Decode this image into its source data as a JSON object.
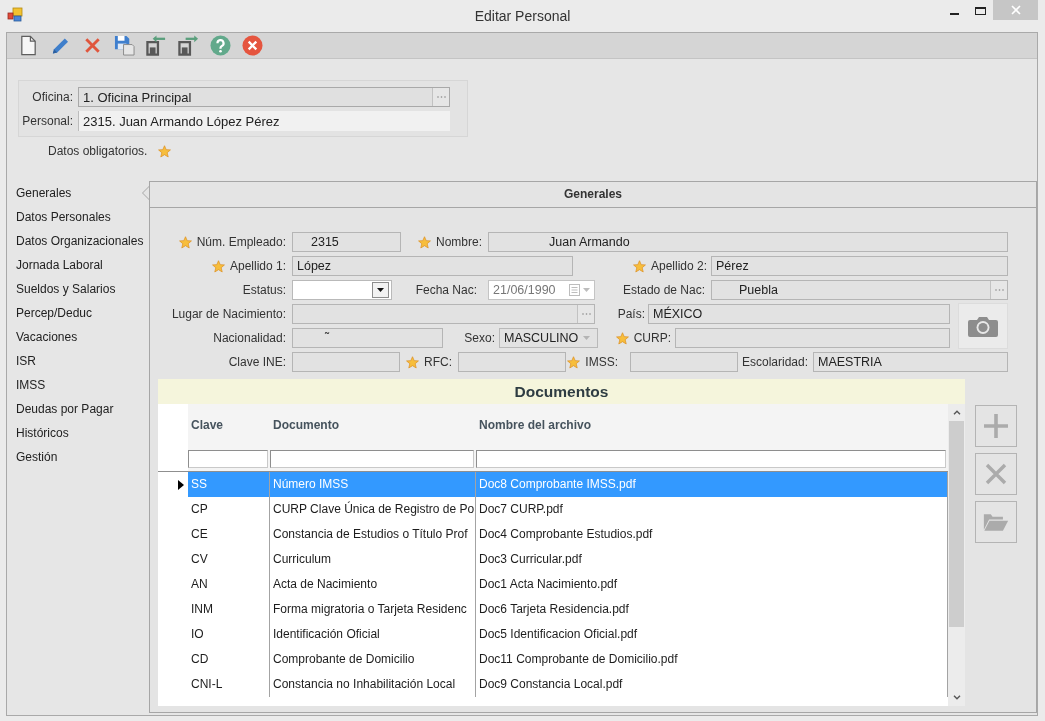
{
  "window": {
    "title": "Editar Personal"
  },
  "header": {
    "fields": [
      {
        "label": "Oficina:",
        "value": "1. Oficina Principal",
        "kind": "lookup"
      },
      {
        "label": "Personal:",
        "value": "2315. Juan Armando López Pérez",
        "kind": "text"
      }
    ],
    "required_note": "Datos obligatorios."
  },
  "sidebar": {
    "items": [
      {
        "label": "Generales",
        "selected": true
      },
      {
        "label": "Datos Personales",
        "selected": false
      },
      {
        "label": "Datos Organizacionales",
        "selected": false
      },
      {
        "label": "Jornada Laboral",
        "selected": false
      },
      {
        "label": "Sueldos y Salarios",
        "selected": false
      },
      {
        "label": "Percep/Deduc",
        "selected": false
      },
      {
        "label": "Vacaciones",
        "selected": false
      },
      {
        "label": "ISR",
        "selected": false
      },
      {
        "label": "IMSS",
        "selected": false
      },
      {
        "label": "Deudas por Pagar",
        "selected": false
      },
      {
        "label": "Históricos",
        "selected": false
      },
      {
        "label": "Gestión",
        "selected": false
      }
    ]
  },
  "panel": {
    "title": "Generales",
    "form": {
      "rows": [
        {
          "fields": [
            {
              "label": "Núm. Empleado:",
              "value": "2315",
              "required": true,
              "kind": "text",
              "disabled": false
            },
            {
              "label": "Nombre:",
              "value": "Juan Armando",
              "required": true,
              "kind": "text",
              "disabled": false
            }
          ]
        },
        {
          "fields": [
            {
              "label": "Apellido 1:",
              "value": "López",
              "required": true,
              "kind": "text",
              "disabled": false
            },
            {
              "label": "Apellido 2:",
              "value": "Pérez",
              "required": true,
              "kind": "text",
              "disabled": false
            }
          ]
        },
        {
          "fields": [
            {
              "label": "Estatus:",
              "required": false,
              "kind": "combo",
              "disabled": false
            },
            {
              "label": "Fecha Nac:",
              "value": "21/06/1990",
              "required": false,
              "kind": "date",
              "disabled": true
            },
            {
              "label": "Estado de Nac:",
              "value": "Puebla",
              "required": false,
              "kind": "lookup",
              "disabled": false
            }
          ]
        },
        {
          "fields": [
            {
              "label": "Lugar de Nacimiento:",
              "required": false,
              "kind": "lookup",
              "disabled": false
            },
            {
              "label": "País:",
              "value": "MÉXICO",
              "required": false,
              "kind": "text",
              "disabled": false
            }
          ]
        },
        {
          "fields": [
            {
              "label": "Nacionalidad:",
              "value": "˜",
              "required": false,
              "kind": "text",
              "disabled": false
            },
            {
              "label": "Sexo:",
              "value": "MASCULINO",
              "required": false,
              "kind": "combo",
              "disabled": true
            },
            {
              "label": "CURP:",
              "required": true,
              "kind": "text",
              "disabled": false
            }
          ]
        },
        {
          "fields": [
            {
              "label": "Clave INE:",
              "required": false,
              "kind": "text",
              "disabled": false
            },
            {
              "label": "RFC:",
              "required": true,
              "kind": "text",
              "disabled": false
            },
            {
              "label": "IMSS:",
              "required": true,
              "kind": "text",
              "disabled": false
            },
            {
              "label": "Escolaridad:",
              "value": "MAESTRIA",
              "required": false,
              "kind": "text",
              "disabled": false
            }
          ]
        }
      ]
    },
    "documents": {
      "title": "Documentos",
      "columns": [
        "Clave",
        "Documento",
        "Nombre del archivo"
      ],
      "rows": [
        {
          "cells": [
            "SS",
            "Número IMSS",
            "Doc8 Comprobante IMSS.pdf"
          ],
          "selected": true
        },
        {
          "cells": [
            "CP",
            "CURP Clave Única de Registro de Po",
            "Doc7 CURP.pdf"
          ],
          "selected": false
        },
        {
          "cells": [
            "CE",
            "Constancia de Estudios o Título Prof",
            "Doc4 Comprobante Estudios.pdf"
          ],
          "selected": false
        },
        {
          "cells": [
            "CV",
            "Curriculum",
            "Doc3 Curricular.pdf"
          ],
          "selected": false
        },
        {
          "cells": [
            "AN",
            "Acta de Nacimiento",
            "Doc1 Acta Nacimiento.pdf"
          ],
          "selected": false
        },
        {
          "cells": [
            "INM",
            "Forma migratoria o Tarjeta Residenc",
            "Doc6 Tarjeta Residencia.pdf"
          ],
          "selected": false
        },
        {
          "cells": [
            "IO",
            "Identificación Oficial",
            "Doc5 Identificacion Oficial.pdf"
          ],
          "selected": false
        },
        {
          "cells": [
            "CD",
            "Comprobante de Domicilio",
            "Doc11 Comprobante de Domicilio.pdf"
          ],
          "selected": false
        },
        {
          "cells": [
            "CNI-L",
            "Constancia no Inhabilitación Local",
            "Doc9 Constancia Local.pdf"
          ],
          "selected": false
        }
      ],
      "action_buttons": [
        {
          "disabled": true
        },
        {
          "disabled": true
        },
        {
          "disabled": true
        }
      ]
    }
  }
}
